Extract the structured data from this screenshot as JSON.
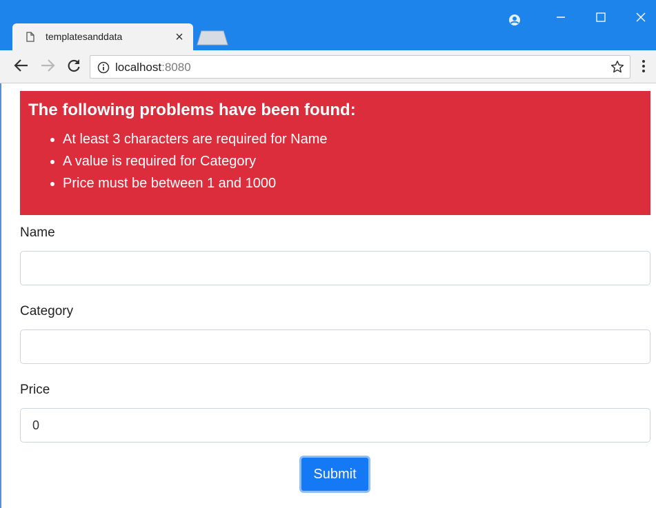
{
  "browser": {
    "tab_title": "templatesanddata",
    "tab_close": "×",
    "url_host": "localhost",
    "url_port": ":8080"
  },
  "alert": {
    "heading": "The following problems have been found:",
    "items": [
      "At least 3 characters are required for Name",
      "A value is required for Category",
      "Price must be between 1 and 1000"
    ]
  },
  "form": {
    "name_label": "Name",
    "name_value": "",
    "category_label": "Category",
    "category_value": "",
    "price_label": "Price",
    "price_value": "0",
    "submit_label": "Submit"
  },
  "colors": {
    "titlebar": "#1c84ea",
    "alert_bg": "#dc2d3d",
    "button_bg": "#1578f5"
  },
  "icons": [
    "document-icon",
    "account-icon",
    "minimize-icon",
    "maximize-icon",
    "close-window-icon",
    "back-icon",
    "forward-icon",
    "reload-icon",
    "info-icon",
    "star-icon",
    "menu-icon"
  ]
}
